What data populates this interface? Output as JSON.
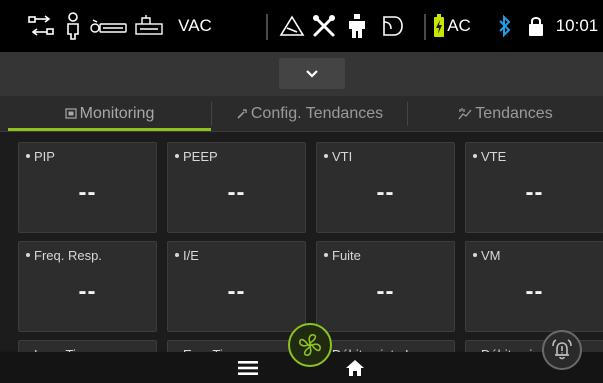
{
  "statusbar": {
    "mode": "VAC",
    "power": "AC",
    "time": "10:01",
    "icons": [
      "circuit-icon",
      "patient-icon",
      "oxygen-icon",
      "nebulizer-icon",
      "alarm-triangle-icon",
      "tools-icon",
      "person-icon",
      "mask-icon",
      "battery-charging-icon",
      "bluetooth-icon",
      "lock-icon"
    ]
  },
  "tabs": [
    {
      "label": "Monitoring",
      "icon": "monitor-icon",
      "active": true
    },
    {
      "label": "Config. Tendances",
      "icon": "config-icon",
      "active": false
    },
    {
      "label": "Tendances",
      "icon": "trends-icon",
      "active": false
    }
  ],
  "cards": [
    {
      "label": "PIP",
      "value": "--"
    },
    {
      "label": "PEEP",
      "value": "--"
    },
    {
      "label": "VTI",
      "value": "--"
    },
    {
      "label": "VTE",
      "value": "--"
    },
    {
      "label": "Freq. Resp.",
      "value": "--"
    },
    {
      "label": "I/E",
      "value": "--"
    },
    {
      "label": "Fuite",
      "value": "--"
    },
    {
      "label": "VM",
      "value": "--"
    },
    {
      "label": "Insp. Time",
      "value": ""
    },
    {
      "label": "Exp. Time",
      "value": ""
    },
    {
      "label": "Débit pointe I",
      "value": ""
    },
    {
      "label": "Débit poin",
      "value": ""
    }
  ],
  "colors": {
    "accent": "#8dc21f",
    "bluetooth": "#1ea0e6",
    "battery": "#c9e600"
  }
}
